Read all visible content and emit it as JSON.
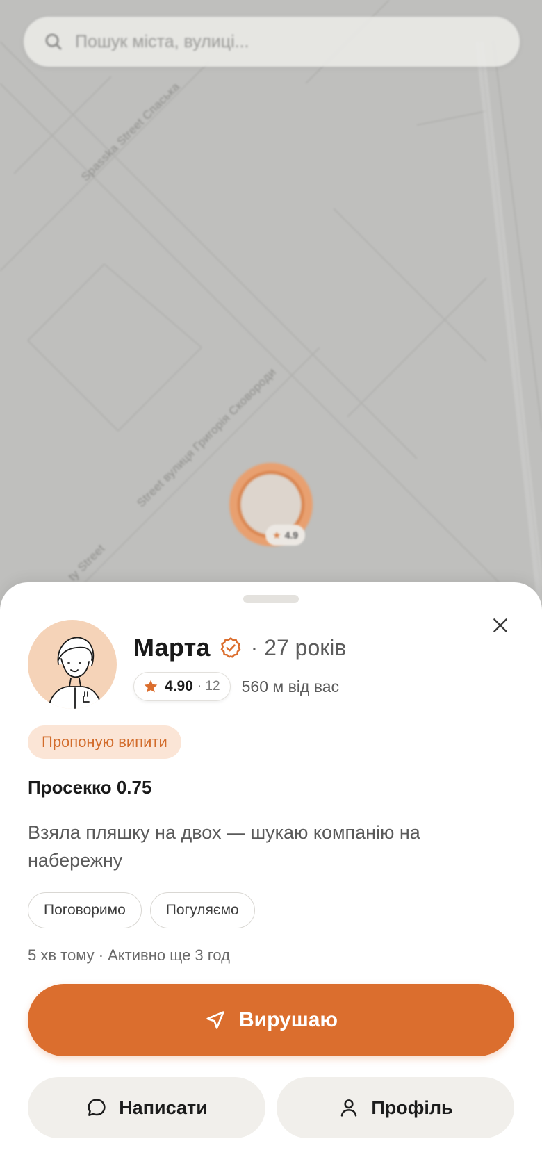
{
  "map": {
    "search_placeholder": "Пошук міста, вулиці...",
    "road_labels": [
      "Spasska Street Спаська",
      "Street вулиця Григорія Сковороди",
      "ty Street"
    ],
    "pin_rating": "4.9"
  },
  "profile": {
    "name": "Марта",
    "age": "· 27 років",
    "rating": "4.90",
    "rating_count": "· 12",
    "distance": "560 м від вас",
    "verified": true
  },
  "offer": {
    "badge": "Пропоную випити",
    "drink": "Просекко 0.75",
    "description": "Взяла пляшку на двох — шукаю компанію на набережну",
    "tags": [
      "Поговоримо",
      "Погуляємо"
    ],
    "meta": "5 хв тому · Активно ще 3 год"
  },
  "actions": {
    "primary": "Вирушаю",
    "message": "Написати",
    "profile": "Профіль"
  },
  "colors": {
    "accent": "#db6e2e",
    "badge_bg": "#fbe5d6",
    "avatar_bg": "#f5d3b8",
    "secondary_bg": "#f1efeb"
  },
  "icons": {
    "search": "search-icon",
    "verified": "verified-badge-icon",
    "star": "star-icon",
    "close": "close-icon",
    "navigate": "navigation-arrow-icon",
    "message": "chat-bubble-icon",
    "profile": "user-icon"
  }
}
